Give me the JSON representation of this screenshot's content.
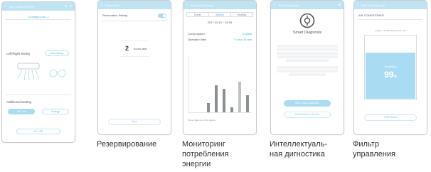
{
  "screens": [
    {
      "title": "AIR CONDITIONER",
      "mode": "Cooling (Cool...)",
      "left_right_swing": "Left/Right Swing",
      "auto_swing": "Auto Swing",
      "additional_setting": "Additional Setting",
      "pill_a": "Jet Cool",
      "pill_b": "Energy",
      "bottom": "On / Off"
    },
    {
      "title": "Reservation",
      "setting": "Reservation Setting",
      "value": "2",
      "unit": "hours later",
      "bottom": "Save"
    },
    {
      "title": "Energy Monitoring",
      "tabs": [
        "Power",
        "Weekly",
        "Monthly"
      ],
      "active_tab": "Weekly",
      "date_range": "2017.03.10 ~ 03.09",
      "consumption_label": "Consumption:",
      "consumption_value": "0.1kWh",
      "operation_label": "Operation time",
      "operation_value": "0 hour 33 min",
      "legend": "Power value to on the display"
    },
    {
      "title": "Smart Diagnosis",
      "heading": "Smart Diagnosis",
      "button": "Start Smart Diagnosis",
      "link": "Call Customer Service"
    },
    {
      "title": "Filter Management",
      "device": "AIR CONDITIONER",
      "usage": "Usage: 0 hr  Remaining time: 0 hr",
      "label": "Remaining",
      "value": "99",
      "unit": "%",
      "button": "Filter Reset"
    }
  ],
  "captions": {
    "c2": "Резервирование",
    "c3": [
      "Мониторинг",
      "потребления",
      "энергии"
    ],
    "c4": [
      "Интеллектуаль-",
      "ная дигностика"
    ],
    "c5": [
      "Фильтр",
      "управления"
    ]
  },
  "chart_data": {
    "type": "bar",
    "categories": [
      "1",
      "2",
      "3",
      "4",
      "5",
      "6",
      "7",
      "8"
    ],
    "values": [
      0,
      0,
      12,
      35,
      30,
      6,
      40,
      22
    ],
    "title": "",
    "xlabel": "",
    "ylabel": ""
  },
  "colors": {
    "accent": "#3aa9de",
    "light_accent": "#bfe3f2"
  }
}
